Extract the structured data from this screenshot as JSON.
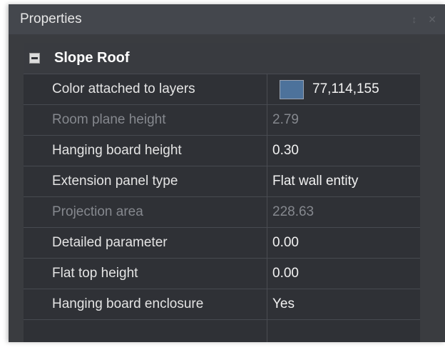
{
  "window": {
    "title": "Properties",
    "title_icons": "↕ ✕"
  },
  "group": {
    "title": "Slope Roof",
    "expanded": true
  },
  "colors": {
    "layer_color": "#4d729b"
  },
  "rows": [
    {
      "name": "Color attached to layers",
      "value": "77,114,155",
      "enabled": true,
      "type": "color"
    },
    {
      "name": "Room plane height",
      "value": "2.79",
      "enabled": false,
      "type": "text"
    },
    {
      "name": "Hanging board height",
      "value": "0.30",
      "enabled": true,
      "type": "text"
    },
    {
      "name": "Extension panel type",
      "value": "Flat wall entity",
      "enabled": true,
      "type": "text"
    },
    {
      "name": "Projection area",
      "value": "228.63",
      "enabled": false,
      "type": "text"
    },
    {
      "name": "Detailed parameter",
      "value": "0.00",
      "enabled": true,
      "type": "text"
    },
    {
      "name": "Flat top height",
      "value": "0.00",
      "enabled": true,
      "type": "text"
    },
    {
      "name": "Hanging board enclosure",
      "value": "Yes",
      "enabled": true,
      "type": "text"
    },
    {
      "name": "",
      "value": "",
      "enabled": true,
      "type": "empty"
    }
  ]
}
